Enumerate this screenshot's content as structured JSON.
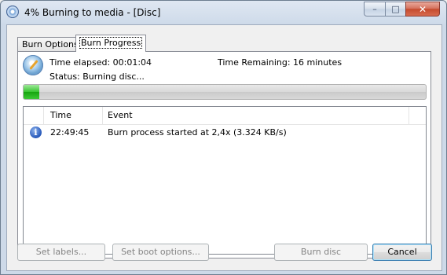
{
  "window": {
    "title": "4% Burning to media - [Disc]",
    "icon": "disc-burn-icon",
    "caption_buttons": {
      "minimize": "–",
      "maximize": "□",
      "close": "✕"
    }
  },
  "tabs": [
    {
      "label": "Burn Options",
      "selected": false
    },
    {
      "label": "Burn Progress",
      "selected": true
    }
  ],
  "status": {
    "time_elapsed": "Time elapsed: 00:01:04",
    "time_remaining": "Time Remaining: 16 minutes",
    "status_text": "Status: Burning disc...",
    "progress_percent": 4
  },
  "log": {
    "columns": [
      "Time",
      "Event"
    ],
    "rows": [
      {
        "icon": "info-icon",
        "glyph": "i",
        "time": "22:49:45",
        "event": "Burn process started at 2,4x (3.324 KB/s)"
      }
    ]
  },
  "buttons": {
    "set_labels": "Set labels...",
    "set_boot_options": "Set boot options...",
    "burn_disc": "Burn disc",
    "cancel": "Cancel"
  },
  "colors": {
    "progress_fill": "#17a50f",
    "title_bar": "#cfdbea",
    "close_button": "#c54b2e"
  }
}
